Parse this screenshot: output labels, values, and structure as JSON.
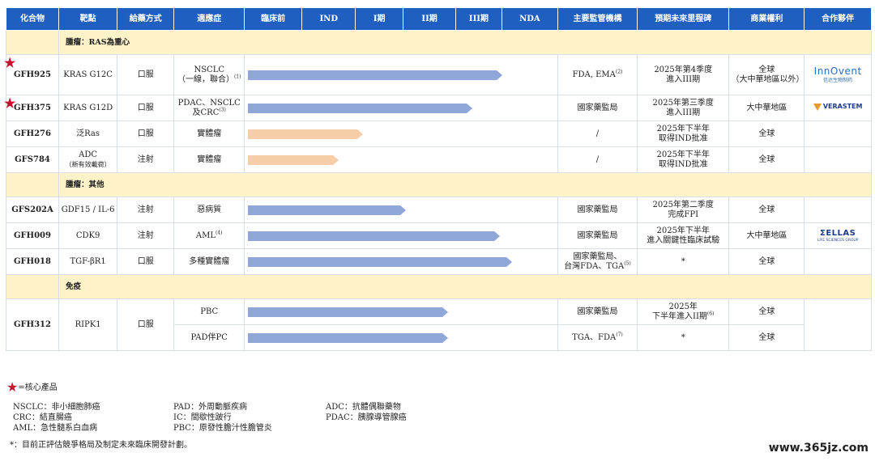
{
  "headers": [
    "化合物",
    "靶點",
    "給藥方式",
    "適應症",
    "臨床前",
    "IND",
    "I期",
    "II期",
    "III期",
    "NDA",
    "主要監管機構",
    "預期未來里程碑",
    "商業權利",
    "合作夥伴"
  ],
  "sections": {
    "s1": "腫瘤：RAS為重心",
    "s2": "腫瘤：其他",
    "s3": "免疫"
  },
  "rows": {
    "gfh925": {
      "compound": "GFH925",
      "target": "KRAS G12C",
      "route": "口服",
      "ind_l1": "NSCLC",
      "ind_l2": "（一線，聯合）",
      "ind_fn": "(1)",
      "progress_fraction": 0.82,
      "reg": "FDA, EMA",
      "reg_fn": "(2)",
      "ms_l1": "2025年第4季度",
      "ms_l2": "進入III期",
      "rights_l1": "全球",
      "rights_l2": "（大中華地區以外）",
      "partner": "innovent-logo",
      "partner_text": "InnOvent",
      "partner_sub": "信达生物制药"
    },
    "gfh375": {
      "compound": "GFH375",
      "target": "KRAS G12D",
      "route": "口服",
      "ind_l1": "PDAC、NSCLC",
      "ind_l2": "及CRC",
      "ind_fn": "(3)",
      "progress_fraction": 0.72,
      "reg": "國家藥監局",
      "ms_l1": "2025年第三季度",
      "ms_l2": "進入III期",
      "rights_l1": "大中華地區",
      "partner": "verastem-logo",
      "partner_text": "VERASTEM"
    },
    "gfh276": {
      "compound": "GFH276",
      "target": "泛Ras",
      "route": "口服",
      "ind_l1": "實體瘤",
      "progress_fraction": 0.36,
      "reg": "/",
      "ms_l1": "2025年下半年",
      "ms_l2": "取得IND批准",
      "rights_l1": "全球"
    },
    "gfs784": {
      "compound": "GFS784",
      "target_l1": "ADC",
      "target_l2": "（新有效載荷）",
      "route": "注射",
      "ind_l1": "實體瘤",
      "progress_fraction": 0.28,
      "reg": "/",
      "ms_l1": "2025年下半年",
      "ms_l2": "取得IND批准",
      "rights_l1": "全球"
    },
    "gfs202a": {
      "compound": "GFS202A",
      "target": "GDF15 / IL-6",
      "route": "注射",
      "ind_l1": "惡病質",
      "progress_fraction": 0.5,
      "reg": "國家藥監局",
      "ms_l1": "2025年第二季度",
      "ms_l2": "完成FPI",
      "rights_l1": "全球"
    },
    "gfh009": {
      "compound": "GFH009",
      "target": "CDK9",
      "route": "注射",
      "ind_l1": "AML",
      "ind_fn": "(4)",
      "progress_fraction": 0.81,
      "reg": "國家藥監局",
      "ms_l1": "2025年下半年",
      "ms_l2": "進入關鍵性臨床試驗",
      "rights_l1": "大中華地區",
      "partner": "sellas-logo",
      "partner_text": "ΣELLAS",
      "partner_sub": "LIFE SCIENCES GROUP"
    },
    "gfh018": {
      "compound": "GFH018",
      "target": "TGF-βR1",
      "route": "口服",
      "ind_l1": "多種實體瘤",
      "progress_fraction": 0.85,
      "reg_l1": "國家藥監局、",
      "reg_l2": "台灣FDA、TGA",
      "reg_fn": "(5)",
      "ms_l1": "*",
      "rights_l1": "全球"
    },
    "gfh312a": {
      "compound": "GFH312",
      "target": "RIPK1",
      "route": "口服",
      "ind_l1": "PBC",
      "progress_fraction": 0.64,
      "reg": "國家藥監局",
      "ms_l1": "2025年",
      "ms_l2": "下半年進入II期",
      "ms_fn": "(6)",
      "rights_l1": "全球"
    },
    "gfh312b": {
      "ind_l1": "PAD伴PC",
      "progress_fraction": 0.64,
      "reg": "TGA、FDA",
      "reg_fn": "(7)",
      "ms_l1": "*",
      "rights_l1": "全球"
    }
  },
  "legend": {
    "core": "=核心產品",
    "col1": [
      "NSCLC：非小細胞肺癌",
      "CRC：結直腸癌",
      "AML：急性髓系白血病"
    ],
    "col2": [
      "PAD：外周動脈疾病",
      "IC：間歇性跛行",
      "PBC：原發性膽汁性膽管炎"
    ],
    "col3": [
      "ADC：抗體偶聯藥物",
      "PDAC：胰腺導管腺癌"
    ],
    "note": "*：目前正評估競爭格局及制定未來臨床開發計劃。"
  },
  "watermark": "www.365jz.com",
  "colors": {
    "header": "#1f5fbf",
    "section": "#fdf2c8",
    "bar_clinical": "#8ea6d8",
    "bar_preclinical": "#f7cda8",
    "star": "#c8102e"
  }
}
